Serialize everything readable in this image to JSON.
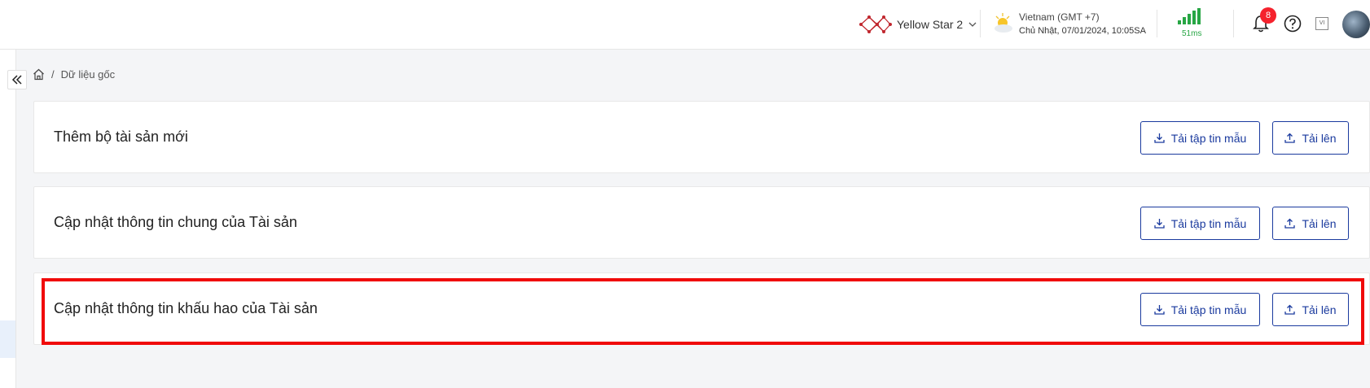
{
  "header": {
    "org_name": "Yellow Star 2",
    "timezone": "Vietnam (GMT +7)",
    "datetime": "Chủ Nhật, 07/01/2024, 10:05SA",
    "ping": "51ms",
    "notification_count": "8",
    "language": "VI"
  },
  "breadcrumb": {
    "separator": "/",
    "current": "Dữ liệu gốc"
  },
  "cards": [
    {
      "title": "Thêm bộ tài sản mới",
      "template_label": "Tải tập tin mẫu",
      "upload_label": "Tải lên"
    },
    {
      "title": "Cập nhật thông tin chung của Tài sản",
      "template_label": "Tải tập tin mẫu",
      "upload_label": "Tải lên"
    },
    {
      "title": "Cập nhật thông tin khấu hao của Tài sản",
      "template_label": "Tải tập tin mẫu",
      "upload_label": "Tải lên"
    }
  ],
  "colors": {
    "accent": "#1a3a9e",
    "highlight": "#f00a0a",
    "signal": "#27a644",
    "badge": "#f5222d"
  }
}
